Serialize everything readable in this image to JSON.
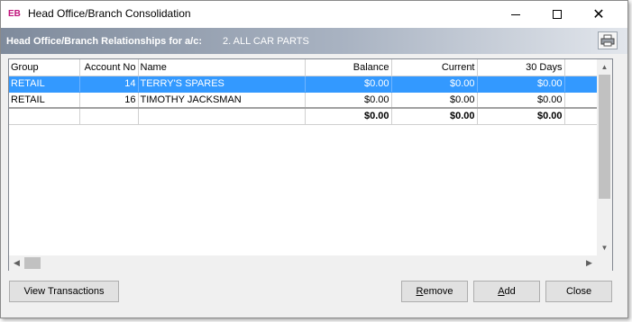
{
  "window": {
    "app_icon_text": "EB",
    "title": "Head Office/Branch Consolidation"
  },
  "header": {
    "label": "Head Office/Branch Relationships for a/c:",
    "account": "2. ALL CAR PARTS",
    "print_icon": "printer-icon"
  },
  "grid": {
    "columns": [
      "Group",
      "Account No",
      "Name",
      "Balance",
      "Current",
      "30 Days"
    ],
    "rows": [
      {
        "group": "RETAIL",
        "account_no": "14",
        "name": "TERRY'S SPARES",
        "balance": "$0.00",
        "current": "$0.00",
        "days30": "$0.00",
        "selected": true
      },
      {
        "group": "RETAIL",
        "account_no": "16",
        "name": "TIMOTHY JACKSMAN",
        "balance": "$0.00",
        "current": "$0.00",
        "days30": "$0.00",
        "selected": false
      }
    ],
    "totals": {
      "balance": "$0.00",
      "current": "$0.00",
      "days30": "$0.00"
    }
  },
  "buttons": {
    "view_transactions": "View Transactions",
    "remove_first": "R",
    "remove_rest": "emove",
    "add_first": "A",
    "add_rest": "dd",
    "close": "Close"
  },
  "colors": {
    "selected_row": "#3399ff",
    "header_bar_start": "#7f8b9c",
    "app_icon": "#c0117a"
  }
}
